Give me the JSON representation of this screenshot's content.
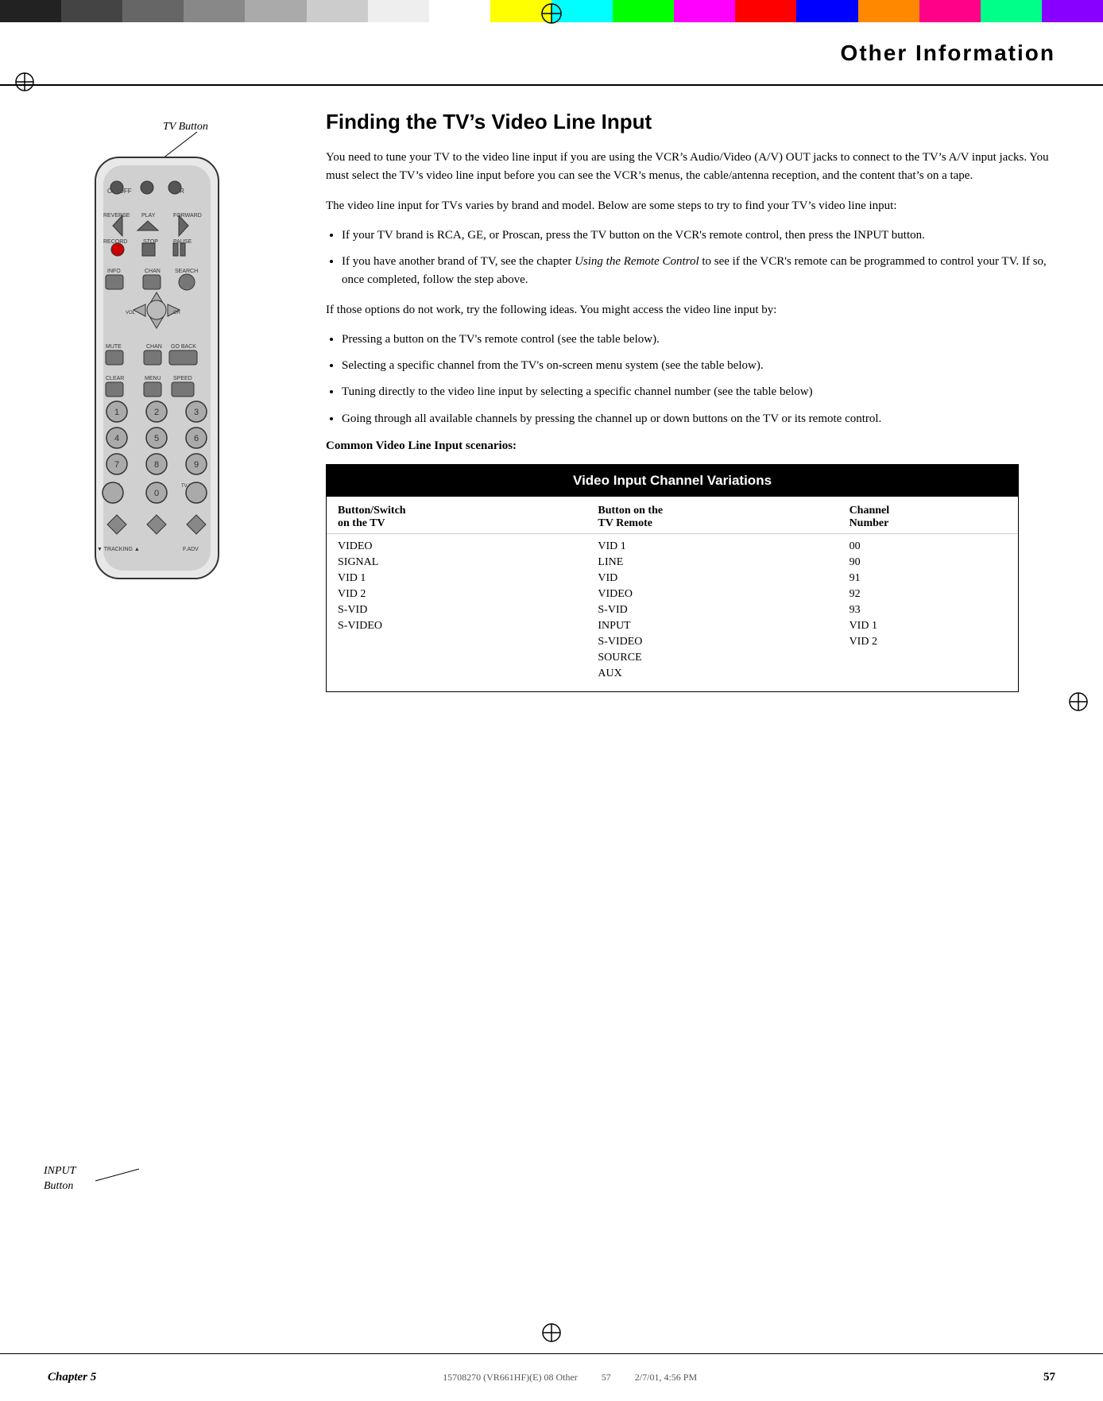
{
  "colorBarsTop": [
    {
      "color": "#1a1a1a"
    },
    {
      "color": "#333"
    },
    {
      "color": "#4d4d4d"
    },
    {
      "color": "#666"
    },
    {
      "color": "#808080"
    },
    {
      "color": "#999"
    },
    {
      "color": "#b3b3b3"
    },
    {
      "color": "#ccc"
    },
    {
      "color": "#e6e6e6"
    },
    {
      "color": "#fff"
    },
    {
      "color": "#ffff00"
    },
    {
      "color": "#00ffff"
    },
    {
      "color": "#00ff00"
    },
    {
      "color": "#ff00ff"
    },
    {
      "color": "#ff0000"
    },
    {
      "color": "#0000ff"
    },
    {
      "color": "#ff8800"
    },
    {
      "color": "#ff0088"
    },
    {
      "color": "#00ff88"
    },
    {
      "color": "#8800ff"
    }
  ],
  "header": {
    "title": "Other  Information"
  },
  "leftPanel": {
    "tvButtonLabel": "TV Button",
    "inputButtonLabel": "INPUT\nButton"
  },
  "rightPanel": {
    "sectionTitle": "Finding the TV’s Video Line Input",
    "paragraph1": "You need to tune your TV to the video line input if you are using the VCR’s Audio/Video (A/V) OUT jacks to connect to the TV’s A/V input jacks. You must select the TV’s video line input before you can see the VCR’s menus, the cable/antenna reception, and the content that’s on a tape.",
    "paragraph2": "The video line input for TVs varies by brand and model. Below are some steps to try to find your TV’s video line input:",
    "bullets": [
      "If your TV brand is RCA, GE, or Proscan, press the TV button on the VCR’s remote control, then press the INPUT button.",
      "If you have another brand of TV, see the chapter Using the Remote Control to see if the VCR’s remote can be programmed to control your TV. If so, once completed, follow the step above."
    ],
    "paragraph3": "If those options do not work, try the following ideas. You might access the video line input by:",
    "bullets2": [
      "Pressing a button on the TV’s remote control (see the table below).",
      "Selecting a specific channel from the TV’s on-screen menu system (see the table below).",
      "Tuning directly to the video line input by selecting a specific channel number (see the table below)",
      "Going through all available channels by pressing the channel up or down buttons on the TV or its remote control."
    ],
    "commonScenariosTitle": "Common Video Line Input scenarios:"
  },
  "table": {
    "title": "Video Input Channel Variations",
    "col1Header": "Button/Switch\non the TV",
    "col2Header": "Button on the\nTV Remote",
    "col3Header": "Channel\nNumber",
    "rows": [
      {
        "col1": "VIDEO",
        "col2": "VID 1",
        "col3": "00"
      },
      {
        "col1": "SIGNAL",
        "col2": "LINE",
        "col3": "90"
      },
      {
        "col1": "VID 1",
        "col2": "VID",
        "col3": "91"
      },
      {
        "col1": "VID 2",
        "col2": "VIDEO",
        "col3": "92"
      },
      {
        "col1": "S-VID",
        "col2": "S-VID",
        "col3": "93"
      },
      {
        "col1": "S-VIDEO",
        "col2": "INPUT",
        "col3": "VID 1"
      },
      {
        "col1": "",
        "col2": "S-VIDEO",
        "col3": "VID 2"
      },
      {
        "col1": "",
        "col2": "SOURCE",
        "col3": ""
      },
      {
        "col1": "",
        "col2": "AUX",
        "col3": ""
      }
    ]
  },
  "footer": {
    "chapter": "Chapter 5",
    "pageNum": "57",
    "leftInfo": "15708270 (VR661HF)(E) 08 Other",
    "centerInfo": "57",
    "rightInfo": "2/7/01, 4:56 PM"
  },
  "remote": {
    "clearLabel": "CLEAR",
    "menuLabel": "MENU",
    "speedLabel": "SPEED"
  }
}
